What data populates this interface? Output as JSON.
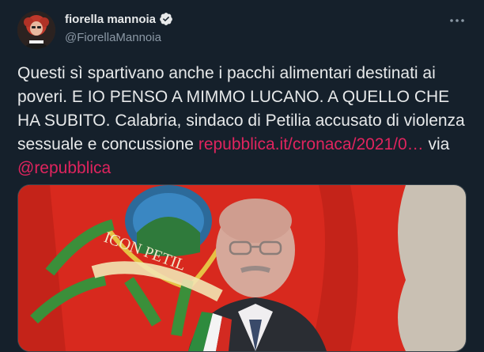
{
  "user": {
    "display_name": "fiorella mannoia",
    "handle": "@FiorellaMannoia"
  },
  "tweet": {
    "text": "Questi sì spartivano anche i pacchi alimentari destinati ai poveri. E IO PENSO A MIMMO LUCANO. A QUELLO CHE HA SUBITO. Calabria, sindaco di Petilia accusato di violenza sessuale e concussione",
    "link_text": "repubblica.it/cronaca/2021/0…",
    "via_text": "via",
    "mention": "@repubblica"
  },
  "media": {
    "banner_text": "ICON PETIL"
  },
  "colors": {
    "background": "#15202b",
    "accent": "#e0245e",
    "verified": "#e7e9ea",
    "banner_red": "#d8291e"
  },
  "icons": [
    "verified-badge-icon",
    "more-options-icon"
  ]
}
